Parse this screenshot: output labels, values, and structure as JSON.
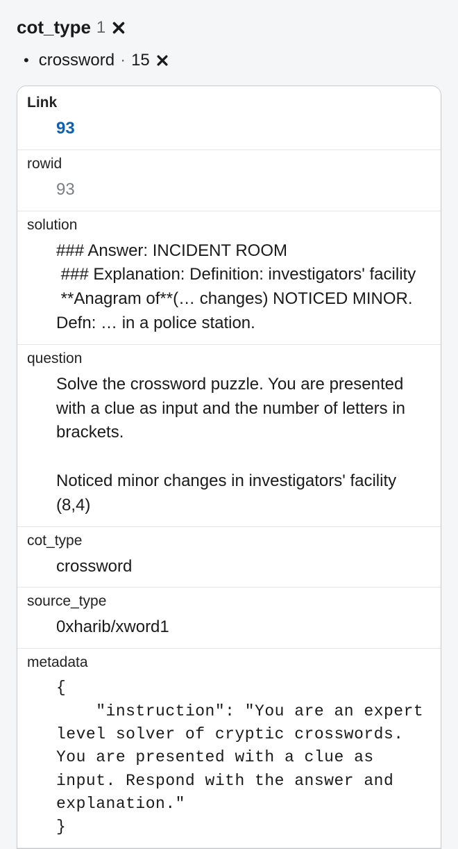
{
  "filter": {
    "name": "cot_type",
    "count": "1",
    "tags": [
      {
        "label": "crossword",
        "count": "15"
      }
    ]
  },
  "record": {
    "fields": [
      {
        "key": "Link",
        "value": "93",
        "style": "link",
        "label_bold": true
      },
      {
        "key": "rowid",
        "value": "93",
        "style": "muted"
      },
      {
        "key": "solution",
        "value": "### Answer: INCIDENT ROOM\n ### Explanation: Definition: investigators' facility\n **Anagram of**(… changes) NOTICED MINOR.\nDefn: … in a police station."
      },
      {
        "key": "question",
        "value": "Solve the crossword puzzle. You are presented with a clue as input and the number of letters in brackets.\n\nNoticed minor changes in investigators' facility (8,4)"
      },
      {
        "key": "cot_type",
        "value": "crossword"
      },
      {
        "key": "source_type",
        "value": "0xharib/xword1"
      },
      {
        "key": "metadata",
        "value": "{\n    \"instruction\": \"You are an expert level solver of cryptic crosswords. You are presented with a clue as input. Respond with the answer and explanation.\"\n}",
        "style": "mono"
      }
    ]
  }
}
